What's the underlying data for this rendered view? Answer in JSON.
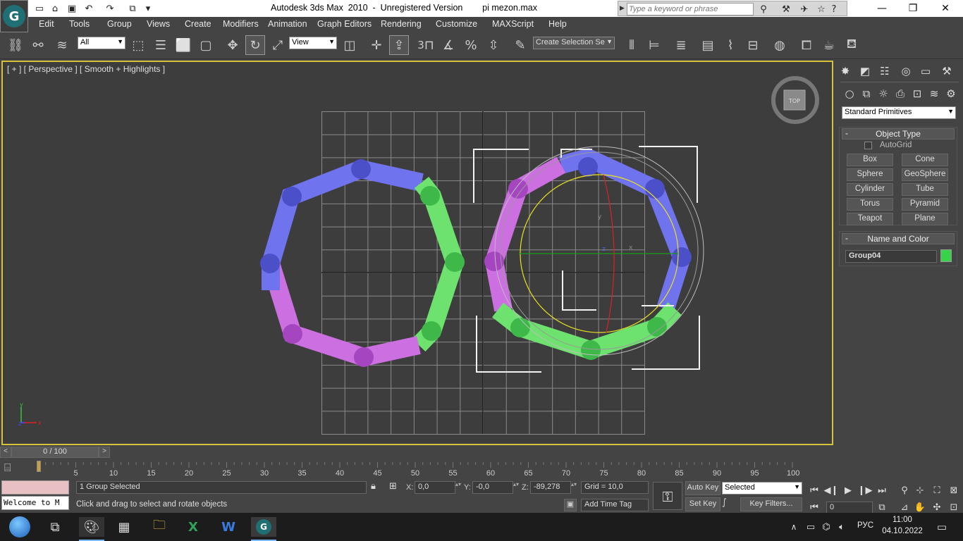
{
  "titlebar": {
    "title": "Autodesk 3ds Max  2010  -  Unregistered Version        pi mezon.max",
    "search_placeholder": "Type a keyword or phrase"
  },
  "menu": [
    "Edit",
    "Tools",
    "Group",
    "Views",
    "Create",
    "Modifiers",
    "Animation",
    "Graph Editors",
    "Rendering",
    "Customize",
    "MAXScript",
    "Help"
  ],
  "toolbar": {
    "filter_value": "All",
    "ref_coord_value": "View",
    "selection_set_placeholder": "Create Selection Se",
    "snap_label": "3"
  },
  "viewport": {
    "label": "[ + ] [ Perspective ] [ Smooth + Highlights ]",
    "viewcube_face": "TOP",
    "axis_labels": {
      "x": "x",
      "y": "y",
      "z": "z"
    }
  },
  "command_panel": {
    "category_value": "Standard Primitives",
    "object_type_header": "Object Type",
    "autogrid_label": "AutoGrid",
    "buttons": [
      "Box",
      "Cone",
      "Sphere",
      "GeoSphere",
      "Cylinder",
      "Tube",
      "Torus",
      "Pyramid",
      "Teapot",
      "Plane"
    ],
    "name_color_header": "Name and Color",
    "object_name": "Group04",
    "object_color": "#37d249"
  },
  "timeline": {
    "frame_display": "0 / 100",
    "ticks": [
      "5",
      "10",
      "15",
      "20",
      "25",
      "30",
      "35",
      "40",
      "45",
      "50",
      "55",
      "60",
      "65",
      "70",
      "75",
      "80",
      "85",
      "90",
      "95",
      "100"
    ]
  },
  "status": {
    "maxscript_text": "Welcome to M",
    "selection_status": "1 Group Selected",
    "prompt": "Click and drag to select and rotate objects",
    "x_value": "0,0",
    "y_value": "-0,0",
    "z_value": "-89,278",
    "x_label": "X:",
    "y_label": "Y:",
    "z_label": "Z:",
    "grid": "Grid = 10,0",
    "add_time_tag": "Add Time Tag",
    "auto_key": "Auto Key",
    "set_key": "Set Key",
    "key_mode_value": "Selected",
    "key_filters": "Key Filters...",
    "frame_value": "0"
  },
  "taskbar": {
    "language": "РУС",
    "time": "11:00",
    "date": "04.10.2022"
  },
  "colors": {
    "viewport_border": "#d6c13a",
    "blue_segment": "#7073ee",
    "green_segment": "#6ee26e",
    "violet_segment": "#cc6fe0"
  }
}
